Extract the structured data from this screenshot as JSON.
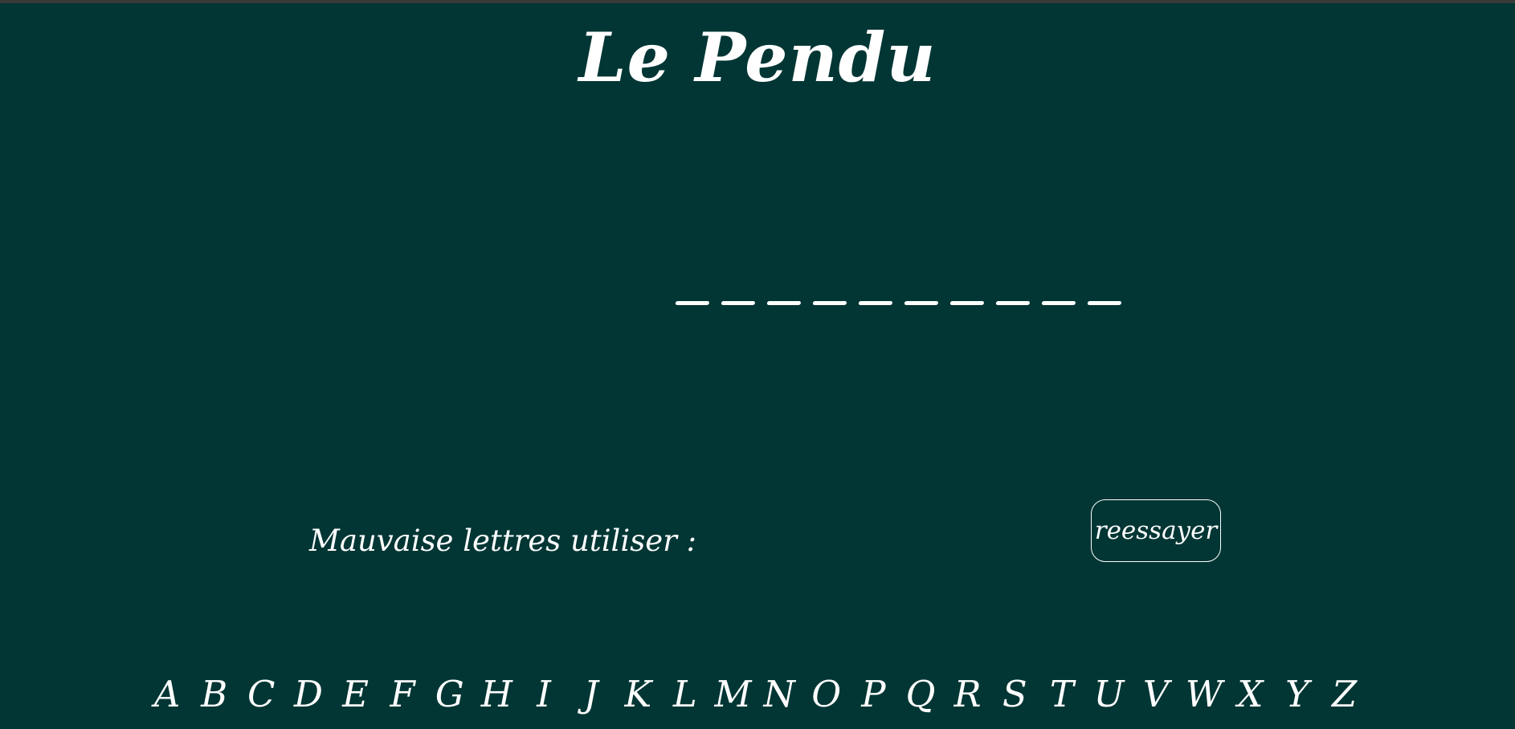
{
  "title": "Le Pendu",
  "word": {
    "blank_count": 10
  },
  "wrong_letters": {
    "label": "Mauvaise lettres utiliser :"
  },
  "retry_button": {
    "label": "reessayer"
  },
  "alphabet": [
    "A",
    "B",
    "C",
    "D",
    "E",
    "F",
    "G",
    "H",
    "I",
    "J",
    "K",
    "L",
    "M",
    "N",
    "O",
    "P",
    "Q",
    "R",
    "S",
    "T",
    "U",
    "V",
    "W",
    "X",
    "Y",
    "Z"
  ],
  "colors": {
    "background": "#013634",
    "text": "#ffffff"
  }
}
